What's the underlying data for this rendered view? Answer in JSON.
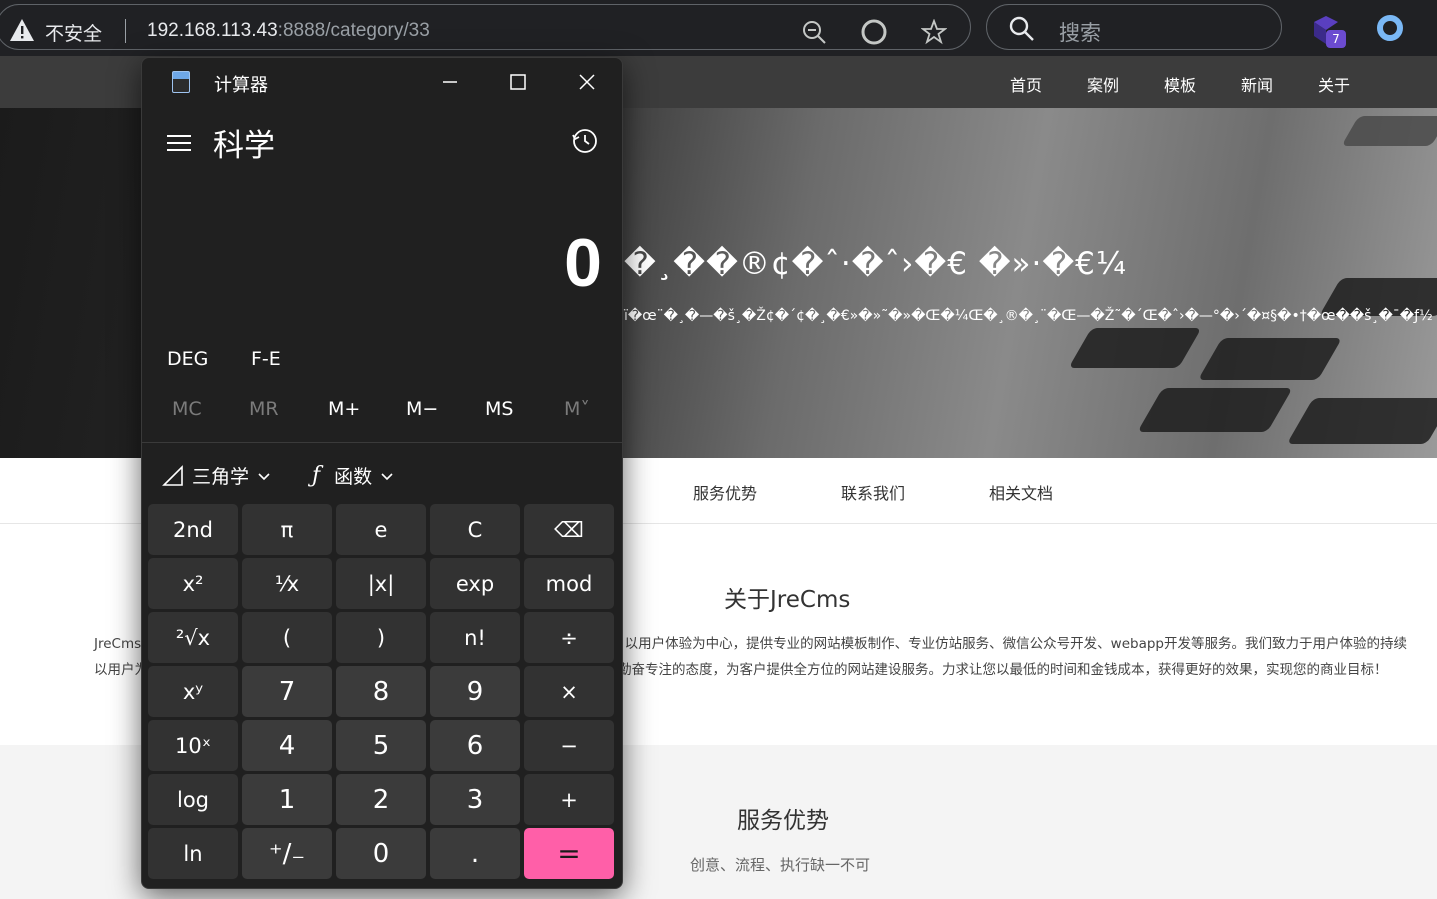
{
  "browser": {
    "security_label": "不安全",
    "url_host": "192.168.113.43",
    "url_rest": ":8888/category/33",
    "search_placeholder": "搜索",
    "extension_badge": "7"
  },
  "site": {
    "nav": [
      "首页",
      "案例",
      "模板",
      "新闻",
      "关于"
    ],
    "hero_title": "�¸��®¢�ˆ·�ˆ›�€ �»·�€¼",
    "hero_subtitle": "ï�œ¨�¸�—�š¸�Ž¢�´¢�¸�€»�»˜�»�Œ�¼Œ�¸®�¸¨�Œ—�Ž˜�´Œ�ˆ›�—°�›´�¤§�•†�œ��š¸�¯�ƒ½",
    "tabs": [
      "服务优势",
      "联系我们",
      "相关文档"
    ],
    "about_title": "关于JreCms",
    "about_line1_left": "JreCms专",
    "about_line1_right": "以用户体验为中心，提供专业的网站模板制作、专业仿站服务、微信公众号开发、webapp开发等服务。我们致力于用户体验的持续",
    "about_line2_left": "以用户为",
    "about_line2_right": "勤奋专注的态度，为客户提供全方位的网站建设服务。力求让您以最低的时间和金钱成本，获得更好的效果，实现您的商业目标！",
    "service_title": "服务优势",
    "service_subtitle": "创意、流程、执行缺一不可"
  },
  "calculator": {
    "window_title": "计算器",
    "mode": "科学",
    "display": "0",
    "angle_mode": "DEG",
    "fe_label": "F-E",
    "memory": [
      "MC",
      "MR",
      "M+",
      "M−",
      "MS",
      "M˅"
    ],
    "trig_label": "三角学",
    "func_label": "函数",
    "keys": [
      {
        "label": "2nd",
        "kind": "fn"
      },
      {
        "label": "π",
        "kind": "fn"
      },
      {
        "label": "e",
        "kind": "fn"
      },
      {
        "label": "C",
        "kind": "fn"
      },
      {
        "label": "⌫",
        "kind": "fn"
      },
      {
        "label": "x²",
        "kind": "fn"
      },
      {
        "label": "¹⁄x",
        "kind": "fn"
      },
      {
        "label": "|x|",
        "kind": "fn"
      },
      {
        "label": "exp",
        "kind": "fn"
      },
      {
        "label": "mod",
        "kind": "fn"
      },
      {
        "label": "²√x",
        "kind": "fn"
      },
      {
        "label": "(",
        "kind": "fn"
      },
      {
        "label": ")",
        "kind": "fn"
      },
      {
        "label": "n!",
        "kind": "fn"
      },
      {
        "label": "÷",
        "kind": "fn"
      },
      {
        "label": "xʸ",
        "kind": "fn"
      },
      {
        "label": "7",
        "kind": "num"
      },
      {
        "label": "8",
        "kind": "num"
      },
      {
        "label": "9",
        "kind": "num"
      },
      {
        "label": "×",
        "kind": "fn"
      },
      {
        "label": "10ˣ",
        "kind": "fn"
      },
      {
        "label": "4",
        "kind": "num"
      },
      {
        "label": "5",
        "kind": "num"
      },
      {
        "label": "6",
        "kind": "num"
      },
      {
        "label": "−",
        "kind": "fn"
      },
      {
        "label": "log",
        "kind": "fn"
      },
      {
        "label": "1",
        "kind": "num"
      },
      {
        "label": "2",
        "kind": "num"
      },
      {
        "label": "3",
        "kind": "num"
      },
      {
        "label": "+",
        "kind": "fn"
      },
      {
        "label": "ln",
        "kind": "fn"
      },
      {
        "label": "⁺∕₋",
        "kind": "num"
      },
      {
        "label": "0",
        "kind": "num"
      },
      {
        "label": ".",
        "kind": "num"
      },
      {
        "label": "=",
        "kind": "eq"
      }
    ],
    "accent": "#ff5fa8"
  }
}
